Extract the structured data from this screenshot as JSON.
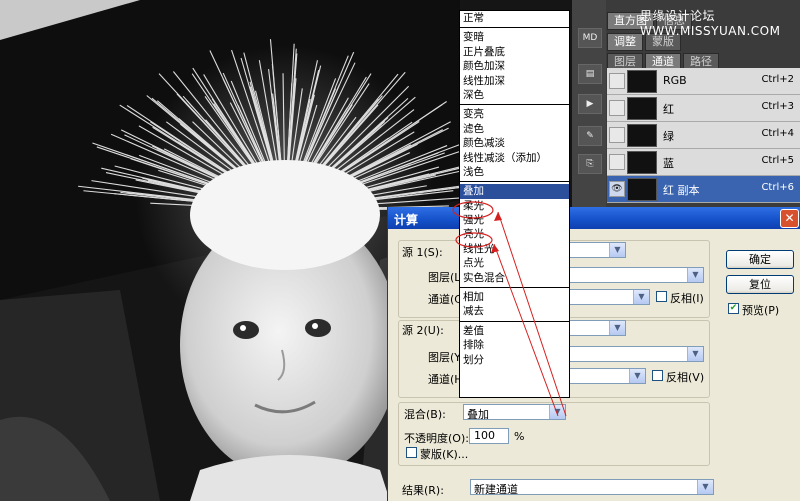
{
  "watermark": "思缘设计论坛 WWW.MISSYUAN.COM",
  "ps_panel": {
    "top_tabs": [
      "直方图",
      "信息"
    ],
    "sub_tabs": [
      "调整",
      "蒙版"
    ],
    "channel_tabs": [
      "图层",
      "通道",
      "路径"
    ],
    "side_icon": "MD",
    "channels": [
      {
        "name": "RGB",
        "shortcut": "Ctrl+2",
        "selected": false
      },
      {
        "name": "红",
        "shortcut": "Ctrl+3",
        "selected": false
      },
      {
        "name": "绿",
        "shortcut": "Ctrl+4",
        "selected": false
      },
      {
        "name": "蓝",
        "shortcut": "Ctrl+5",
        "selected": false
      },
      {
        "name": "红 副本",
        "shortcut": "Ctrl+6",
        "selected": true
      }
    ]
  },
  "blend_modes": {
    "groups": [
      [
        "正常"
      ],
      [
        "变暗",
        "正片叠底",
        "颜色加深",
        "线性加深",
        "深色"
      ],
      [
        "变亮",
        "滤色",
        "颜色减淡",
        "线性减淡（添加）",
        "浅色"
      ],
      [
        "叠加",
        "柔光",
        "强光",
        "亮光",
        "线性光",
        "点光",
        "实色混合"
      ],
      [
        "相加",
        "减去"
      ],
      [
        "差值",
        "排除",
        "划分"
      ]
    ],
    "highlighted": "叠加",
    "circled": [
      "叠加",
      "强光"
    ]
  },
  "dialog": {
    "title": "计算",
    "source1": {
      "label": "源 1(S):",
      "layer_label": "图层(L):",
      "channel_label": "通道(C):",
      "invert_label": "反相(I)"
    },
    "source2": {
      "label": "源 2(U):",
      "layer_label": "图层(Y):",
      "channel_label": "通道(H):",
      "invert_label": "反相(V)"
    },
    "blending": {
      "label": "混合(B):",
      "value": "叠加"
    },
    "opacity": {
      "label": "不透明度(O):",
      "value": "100",
      "unit": "%"
    },
    "mask_label": "蒙版(K)...",
    "result": {
      "label": "结果(R):",
      "value": "新建通道"
    },
    "buttons": {
      "ok": "确定",
      "reset": "复位"
    },
    "preview": {
      "label": "预览(P)",
      "checked": true
    }
  },
  "colors": {
    "selection_blue": "#2b4f9a",
    "annotation_red": "#d42020"
  }
}
